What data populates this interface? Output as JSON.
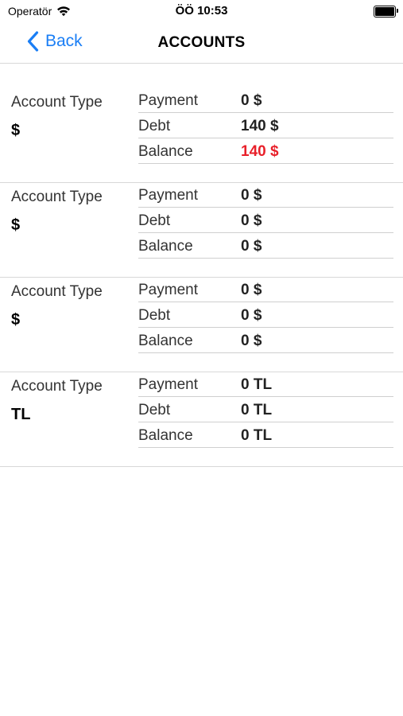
{
  "status_bar": {
    "carrier": "Operatör",
    "time": "ÖÖ 10:53"
  },
  "nav": {
    "back_label": "Back",
    "title": "ACCOUNTS"
  },
  "accounts": [
    {
      "type_label": "Account Type",
      "currency": "$",
      "rows": [
        {
          "label": "Payment",
          "value": "0 $",
          "highlight": false
        },
        {
          "label": "Debt",
          "value": "140 $",
          "highlight": false
        },
        {
          "label": "Balance",
          "value": "140 $",
          "highlight": true
        }
      ]
    },
    {
      "type_label": "Account Type",
      "currency": "$",
      "rows": [
        {
          "label": "Payment",
          "value": "0 $",
          "highlight": false
        },
        {
          "label": "Debt",
          "value": "0 $",
          "highlight": false
        },
        {
          "label": "Balance",
          "value": "0 $",
          "highlight": false
        }
      ]
    },
    {
      "type_label": "Account Type",
      "currency": "$",
      "rows": [
        {
          "label": "Payment",
          "value": "0 $",
          "highlight": false
        },
        {
          "label": "Debt",
          "value": "0 $",
          "highlight": false
        },
        {
          "label": "Balance",
          "value": "0 $",
          "highlight": false
        }
      ]
    },
    {
      "type_label": "Account Type",
      "currency": "TL",
      "rows": [
        {
          "label": "Payment",
          "value": "0 TL",
          "highlight": false
        },
        {
          "label": "Debt",
          "value": "0 TL",
          "highlight": false
        },
        {
          "label": "Balance",
          "value": "0 TL",
          "highlight": false
        }
      ]
    }
  ],
  "colors": {
    "accent": "#1a7ef5",
    "negative": "#e8202a"
  },
  "icons": {
    "back": "chevron-left-icon",
    "wifi": "wifi-icon",
    "battery": "battery-icon"
  }
}
